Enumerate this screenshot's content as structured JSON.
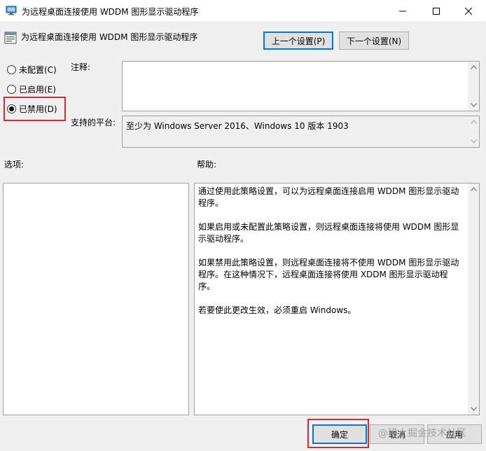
{
  "window": {
    "title": "为远程桌面连接使用 WDDM 图形显示驱动程序",
    "controls": {
      "minimize_icon": "minimize-icon",
      "maximize_icon": "maximize-icon",
      "close_icon": "close-icon"
    }
  },
  "policy": {
    "name": "为远程桌面连接使用 WDDM 图形显示驱动程序",
    "icon": "policy-settings-icon"
  },
  "nav": {
    "prev_label": "上一个设置(P)",
    "next_label": "下一个设置(N)"
  },
  "state": {
    "options": [
      {
        "label": "未配置(C)",
        "checked": false
      },
      {
        "label": "已启用(E)",
        "checked": false
      },
      {
        "label": "已禁用(D)",
        "checked": true
      }
    ]
  },
  "comment": {
    "label": "注释:",
    "value": ""
  },
  "supported": {
    "label": "支持的平台:",
    "value": "至少为 Windows Server 2016、Windows 10 版本 1903"
  },
  "sections": {
    "options_label": "选项:",
    "help_label": "帮助:"
  },
  "help": {
    "paragraphs": [
      "通过使用此策略设置，可以为远程桌面连接启用 WDDM 图形显示驱动程序。",
      "如果启用或未配置此策略设置，则远程桌面连接将使用 WDDM 图形显示驱动程序。",
      "如果禁用此策略设置，则远程桌面连接将不使用 WDDM 图形显示驱动程序。在这种情况下，远程桌面连接将使用 XDDM 图形显示驱动程序。",
      "若要使此更改生效，必须重启 Windows。"
    ]
  },
  "footer": {
    "ok_label": "确定",
    "cancel_label": "取消",
    "apply_label": "应用",
    "watermark": "@稀土掘金技术社区"
  },
  "colors": {
    "highlight_red": "#e0262b",
    "default_button_border": "#0078d7",
    "dialog_background": "#f0f0f0"
  }
}
